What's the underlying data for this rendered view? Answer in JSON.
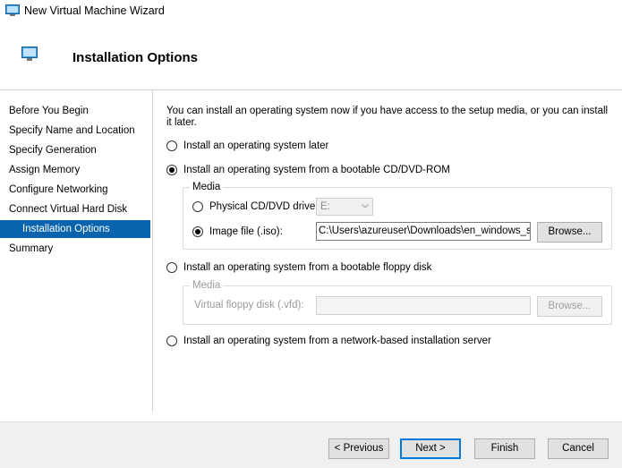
{
  "window": {
    "title": "New Virtual Machine Wizard"
  },
  "header": {
    "heading": "Installation Options"
  },
  "sidebar": {
    "items": [
      {
        "label": "Before You Begin"
      },
      {
        "label": "Specify Name and Location"
      },
      {
        "label": "Specify Generation"
      },
      {
        "label": "Assign Memory"
      },
      {
        "label": "Configure Networking"
      },
      {
        "label": "Connect Virtual Hard Disk"
      },
      {
        "label": "Installation Options",
        "selected": true
      },
      {
        "label": "Summary"
      }
    ]
  },
  "main": {
    "description": "You can install an operating system now if you have access to the setup media, or you can install it later.",
    "options": {
      "later": {
        "label": "Install an operating system later",
        "selected": false
      },
      "cd": {
        "label": "Install an operating system from a bootable CD/DVD-ROM",
        "selected": true
      },
      "floppy": {
        "label": "Install an operating system from a bootable floppy disk",
        "selected": false
      },
      "network": {
        "label": "Install an operating system from a network-based installation server",
        "selected": false
      }
    },
    "cd_media": {
      "group_title": "Media",
      "physical_label": "Physical CD/DVD drive:",
      "physical_selected": false,
      "drive_value": "E:",
      "image_label": "Image file (.iso):",
      "image_selected": true,
      "image_path": "C:\\Users\\azureuser\\Downloads\\en_windows_server",
      "browse_label": "Browse..."
    },
    "floppy_media": {
      "group_title": "Media",
      "vfd_label": "Virtual floppy disk (.vfd):",
      "vfd_value": "",
      "browse_label": "Browse..."
    }
  },
  "footer": {
    "previous_label": "< Previous",
    "next_label": "Next >",
    "finish_label": "Finish",
    "cancel_label": "Cancel"
  },
  "colors": {
    "selection": "#0a64ad",
    "default_button_border": "#0078d7"
  },
  "icons": {
    "title": "virtual-machine-icon",
    "header": "virtual-machine-icon",
    "dropdown": "chevron-down-icon"
  }
}
